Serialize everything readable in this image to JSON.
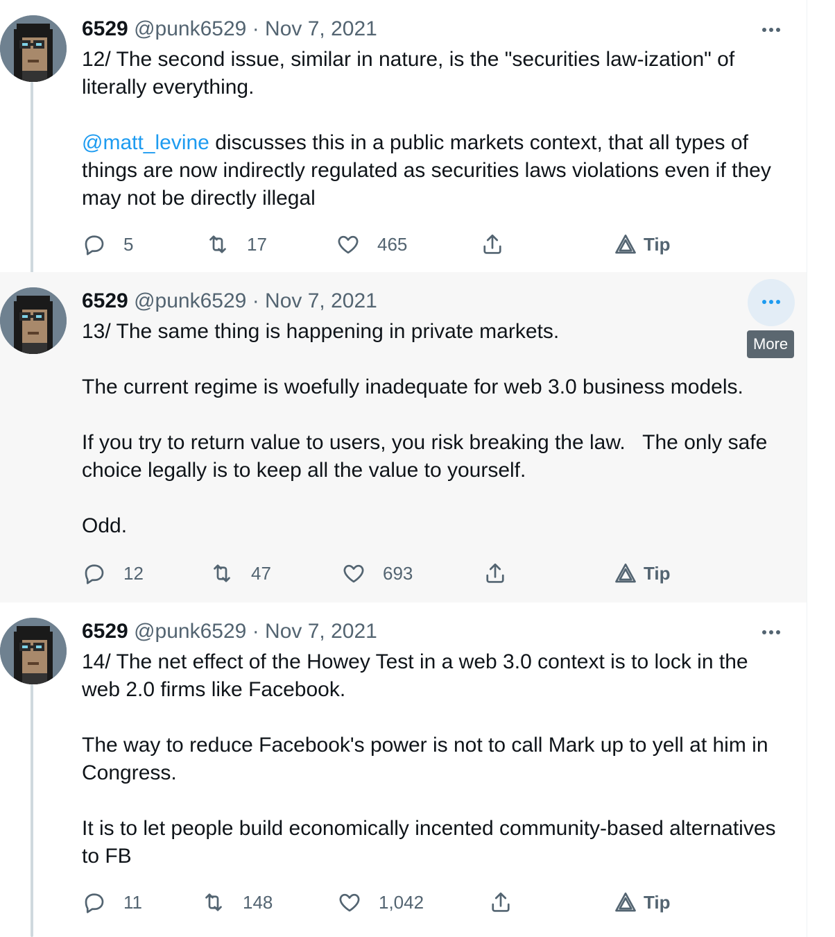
{
  "tweets": [
    {
      "name": "6529",
      "handle": "@punk6529",
      "sep": "·",
      "date": "Nov 7, 2021",
      "paragraphs": [
        "12/ The second issue, similar in nature, is the \"securities law-ization\" of literally everything.",
        " discusses this in a public markets context, that all types of things are now indirectly regulated as securities laws violations even if they may not be directly illegal"
      ],
      "mention": "@matt_levine",
      "replies": "5",
      "retweets": "17",
      "likes": "465",
      "tip": "Tip"
    },
    {
      "name": "6529",
      "handle": "@punk6529",
      "sep": "·",
      "date": "Nov 7, 2021",
      "paragraphs": [
        "13/ The same thing is happening in private markets.",
        "The current regime is woefully inadequate for web 3.0 business models.",
        "If you try to return value to users, you risk breaking the law.   The only safe choice legally is to keep all the value to yourself.",
        "Odd."
      ],
      "tooltip": "More",
      "replies": "12",
      "retweets": "47",
      "likes": "693",
      "tip": "Tip"
    },
    {
      "name": "6529",
      "handle": "@punk6529",
      "sep": "·",
      "date": "Nov 7, 2021",
      "paragraphs": [
        "14/ The net effect of the Howey Test in a web 3.0 context is to lock in the web 2.0 firms like Facebook.",
        "The way to reduce Facebook's power is not to call Mark up to yell at him in Congress.",
        "It is to let people build economically incented community-based alternatives to FB"
      ],
      "replies": "11",
      "retweets": "148",
      "likes": "1,042",
      "tip": "Tip"
    }
  ],
  "colors": {
    "accent": "#1d9bf0",
    "muted": "#536471",
    "hover_bg": "#f7f7f7",
    "thread_line": "#cfd9de"
  },
  "icons": [
    "reply-icon",
    "retweet-icon",
    "like-icon",
    "share-icon",
    "tip-icon",
    "more-icon"
  ]
}
